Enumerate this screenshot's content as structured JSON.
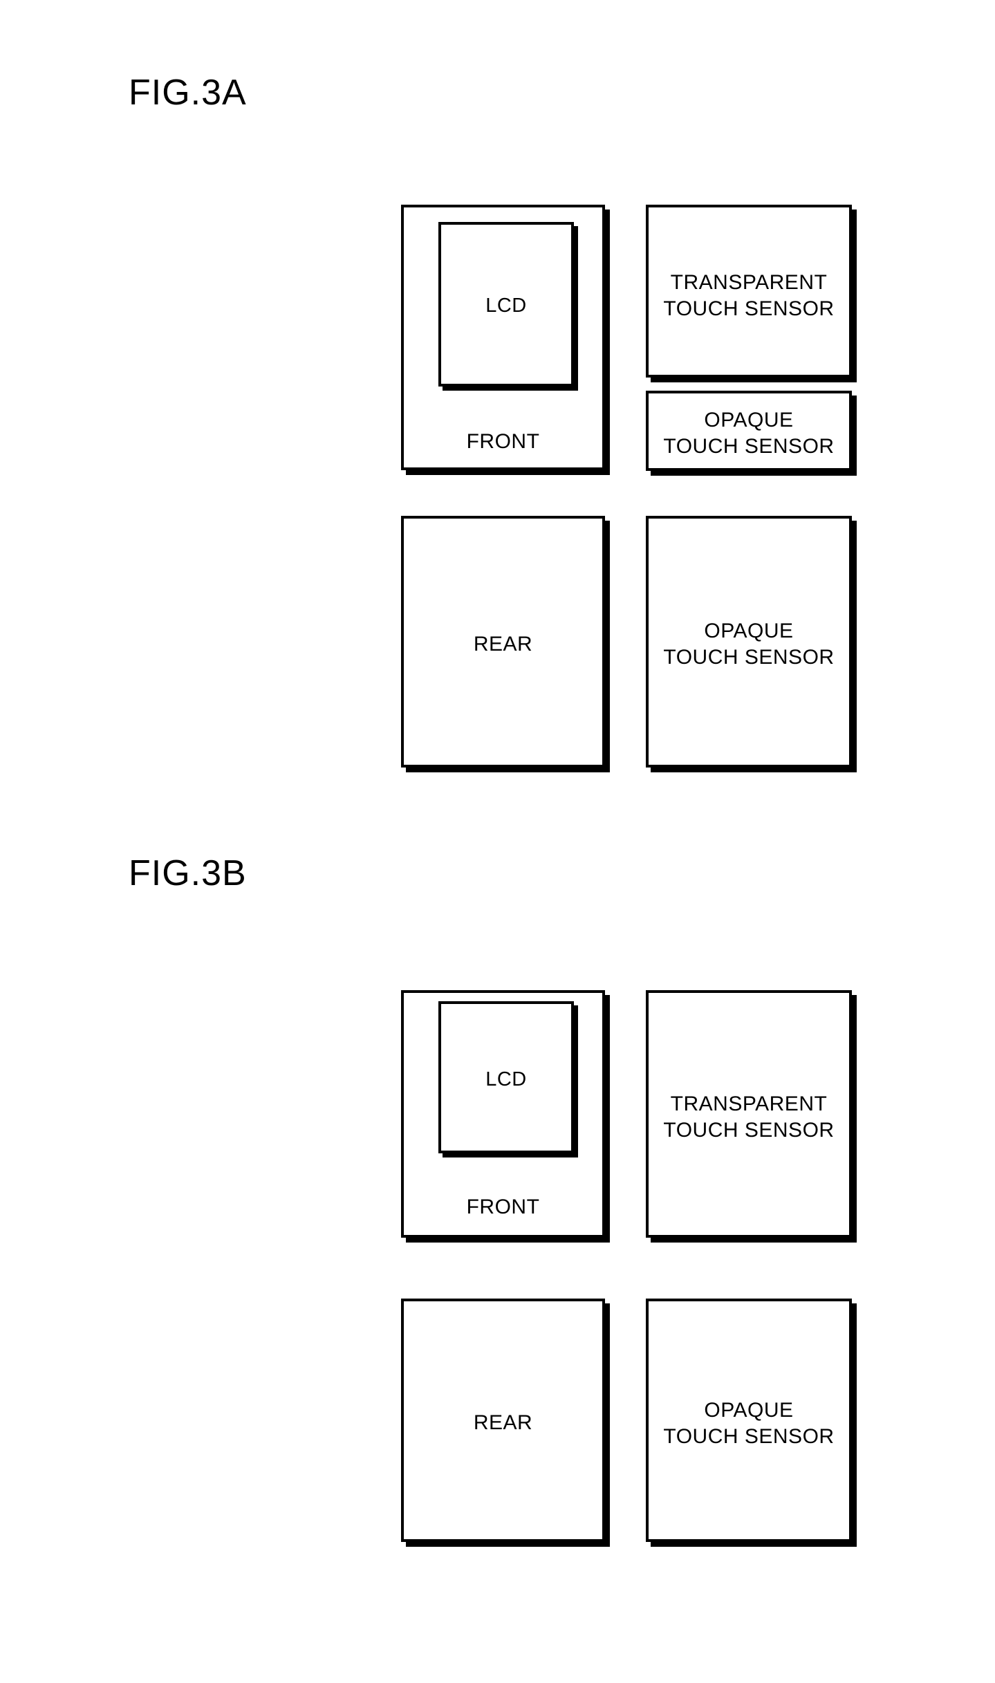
{
  "document": {
    "type": "patent-drawing-sheet",
    "background_color": "#ffffff",
    "ink_color": "#000000"
  },
  "figures": [
    {
      "id": "fig-3a",
      "title": "FIG.3A",
      "boxes": {
        "front": {
          "label": "FRONT",
          "inner": {
            "label": "LCD"
          }
        },
        "transparent_touch_sensor": {
          "label": "TRANSPARENT\nTOUCH SENSOR"
        },
        "opaque_touch_sensor_top": {
          "label": "OPAQUE\nTOUCH SENSOR"
        },
        "rear": {
          "label": "REAR"
        },
        "opaque_touch_sensor_bottom": {
          "label": "OPAQUE\nTOUCH SENSOR"
        }
      }
    },
    {
      "id": "fig-3b",
      "title": "FIG.3B",
      "boxes": {
        "front": {
          "label": "FRONT",
          "inner": {
            "label": "LCD"
          }
        },
        "transparent_touch_sensor": {
          "label": "TRANSPARENT\nTOUCH SENSOR"
        },
        "rear": {
          "label": "REAR"
        },
        "opaque_touch_sensor": {
          "label": "OPAQUE\nTOUCH SENSOR"
        }
      }
    }
  ]
}
